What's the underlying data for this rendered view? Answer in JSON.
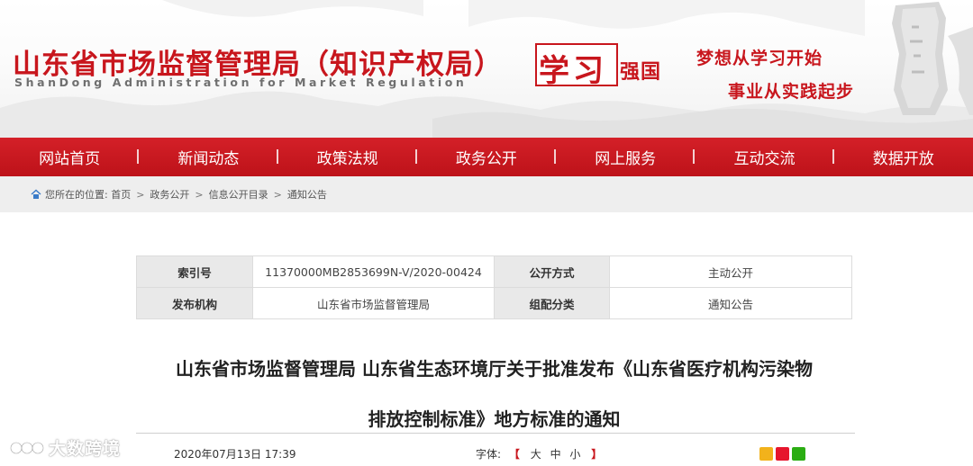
{
  "header": {
    "title": "山东省市场监督管理局（知识产权局）",
    "subtitle": "ShanDong Administration for Market Regulation",
    "logo_main": "学习",
    "logo_side": "强国",
    "slogan_1": "梦想从学习开始",
    "slogan_2": "事业从实践起步"
  },
  "nav": {
    "items": [
      {
        "label": "网站首页"
      },
      {
        "label": "新闻动态"
      },
      {
        "label": "政策法规"
      },
      {
        "label": "政务公开"
      },
      {
        "label": "网上服务"
      },
      {
        "label": "互动交流"
      },
      {
        "label": "数据开放"
      }
    ]
  },
  "breadcrumb": {
    "prefix": "您所在的位置: 首页",
    "items": [
      "政务公开",
      "信息公开目录",
      "通知公告"
    ],
    "separator": ">"
  },
  "info_table": {
    "index_label": "索引号",
    "index_value": "11370000MB2853699N-V/2020-00424",
    "open_label": "公开方式",
    "open_value": "主动公开",
    "publisher_label": "发布机构",
    "publisher_value": "山东省市场监督管理局",
    "category_label": "组配分类",
    "category_value": "通知公告"
  },
  "article": {
    "title_line1": "山东省市场监督管理局 山东省生态环境厅关于批准发布《山东省医疗机构污染物",
    "title_line2": "排放控制标准》地方标准的通知",
    "date": "2020年07月13日 17:39",
    "font_label": "字体:",
    "bracket_open": "【",
    "bracket_close": "】",
    "font_large": "大",
    "font_medium": "中",
    "font_small": "小"
  },
  "watermark": {
    "text": "大数跨境"
  },
  "colors": {
    "brand_red": "#c8161d",
    "nav_bg": "#c8161d",
    "breadcrumb_bg": "#eeeeee",
    "table_key_bg": "#e9e9e9"
  },
  "icons": {
    "home": "home-icon",
    "share": [
      "qzone-share-icon",
      "weibo-share-icon",
      "wechat-share-icon"
    ]
  }
}
